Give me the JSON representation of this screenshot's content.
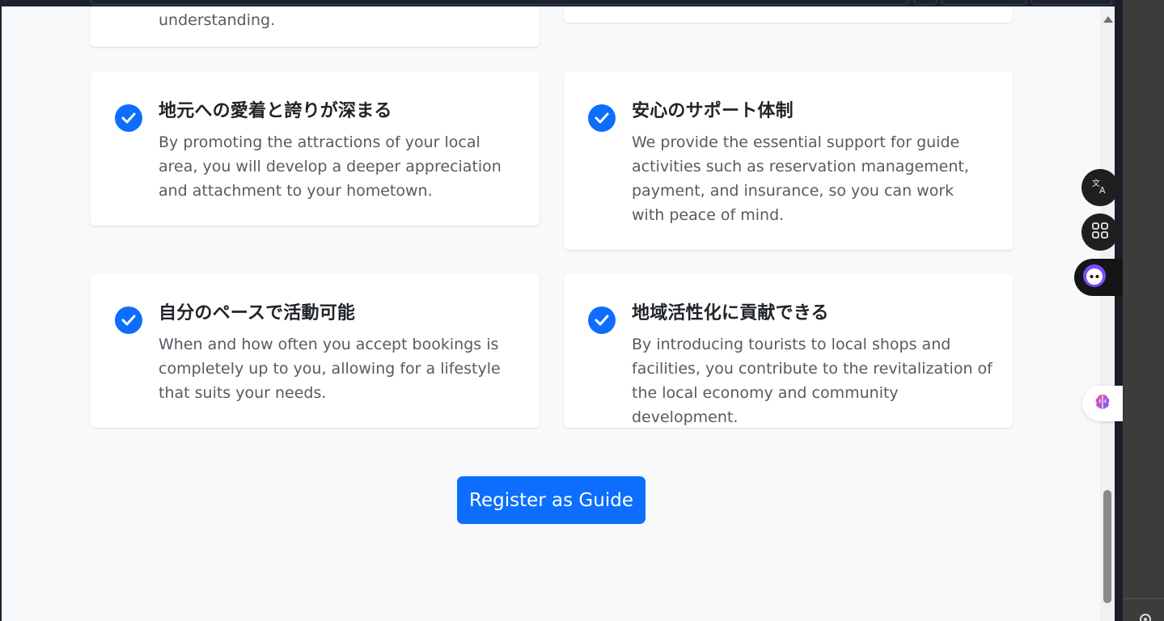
{
  "features": {
    "partial_top_left_text": "understanding.",
    "cards": [
      {
        "title": "地元への愛着と誇りが深まる",
        "text": "By promoting the attractions of your local area, you will develop a deeper appreciation and attachment to your hometown."
      },
      {
        "title": "安心のサポート体制",
        "text": "We provide the essential support for guide activities such as reservation management, payment, and insurance, so you can work with peace of mind."
      },
      {
        "title": "自分のペースで活動可能",
        "text": "When and how often you accept bookings is completely up to you, allowing for a lifestyle that suits your needs."
      },
      {
        "title": "地域活性化に貢献できる",
        "text": "By introducing tourists to local shops and facilities, you contribute to the revitalization of the local economy and community development."
      }
    ]
  },
  "cta": {
    "label": "Register as Guide"
  },
  "colors": {
    "accent": "#0d6efd",
    "background": "#f8f9fb",
    "card": "#ffffff",
    "body_text": "#555b62"
  },
  "extensions": {
    "icons": [
      "translate-icon",
      "apps-grid-icon",
      "assistant-face-icon",
      "brain-icon",
      "gear-icon"
    ]
  }
}
